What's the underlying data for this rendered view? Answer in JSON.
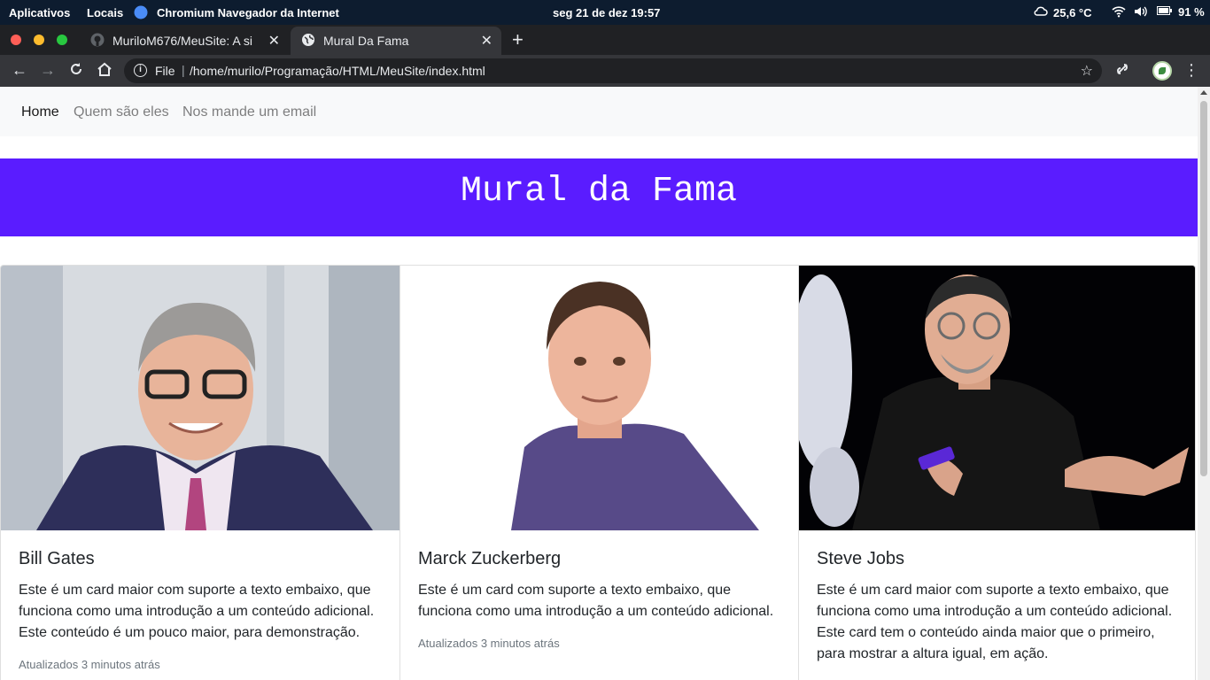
{
  "desktop": {
    "activities": "Aplicativos",
    "places": "Locais",
    "app_name": "Chromium Navegador da Internet",
    "clock": "seg 21 de dez  19:57",
    "weather": "25,6 °C",
    "battery": "91 %"
  },
  "browser": {
    "tabs": [
      {
        "title": "MuriloM676/MeuSite: A si",
        "icon": "github-icon"
      },
      {
        "title": "Mural Da Fama",
        "icon": "globe-icon"
      }
    ],
    "omnibox": {
      "scheme_label": "File",
      "url": "/home/murilo/Programação/HTML/MeuSite/index.html"
    }
  },
  "site": {
    "nav": [
      "Home",
      "Quem são eles",
      "Nos mande um email"
    ],
    "jumbotron_title": "Mural da Fama",
    "colors": {
      "jumbotron": "#5a1cff",
      "navbar": "#f8f9fa"
    },
    "cards": [
      {
        "title": "Bill Gates",
        "text": "Este é um card maior com suporte a texto embaixo, que funciona como uma introdução a um conteúdo adicional. Este conteúdo é um pouco maior, para demonstração.",
        "footer": "Atualizados 3 minutos atrás"
      },
      {
        "title": "Marck Zuckerberg",
        "text": "Este é um card com suporte a texto embaixo, que funciona como uma introdução a um conteúdo adicional.",
        "footer": "Atualizados 3 minutos atrás"
      },
      {
        "title": "Steve Jobs",
        "text": "Este é um card maior com suporte a texto embaixo, que funciona como uma introdução a um conteúdo adicional. Este card tem o conteúdo ainda maior que o primeiro, para mostrar a altura igual, em ação.",
        "footer": ""
      }
    ]
  }
}
